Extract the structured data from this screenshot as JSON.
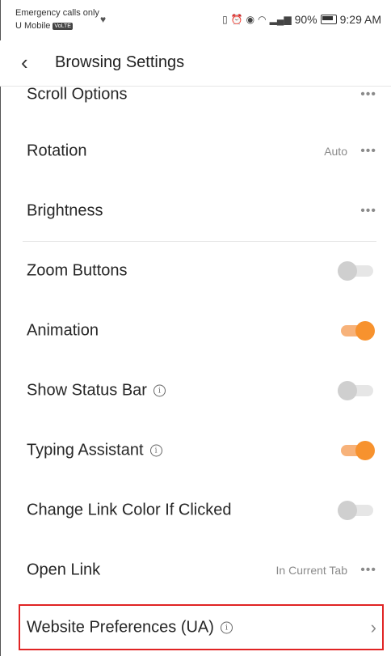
{
  "status_bar": {
    "carrier_line1": "Emergency calls only",
    "carrier_line2": "U Mobile",
    "volte_badge": "VoLTE",
    "battery": "90%",
    "time": "9:29 AM"
  },
  "header": {
    "title": "Browsing Settings"
  },
  "rows": {
    "scroll_options": {
      "label": "Scroll Options"
    },
    "rotation": {
      "label": "Rotation",
      "value": "Auto"
    },
    "brightness": {
      "label": "Brightness"
    },
    "zoom_buttons": {
      "label": "Zoom Buttons",
      "enabled": false
    },
    "animation": {
      "label": "Animation",
      "enabled": true
    },
    "show_status_bar": {
      "label": "Show Status Bar",
      "enabled": false
    },
    "typing_assistant": {
      "label": "Typing Assistant",
      "enabled": true
    },
    "change_link_color": {
      "label": "Change Link Color If Clicked",
      "enabled": false
    },
    "open_link": {
      "label": "Open Link",
      "value": "In Current Tab"
    },
    "website_preferences": {
      "label": "Website Preferences (UA)"
    }
  },
  "colors": {
    "accent": "#f7922e",
    "highlight": "#e02424"
  }
}
